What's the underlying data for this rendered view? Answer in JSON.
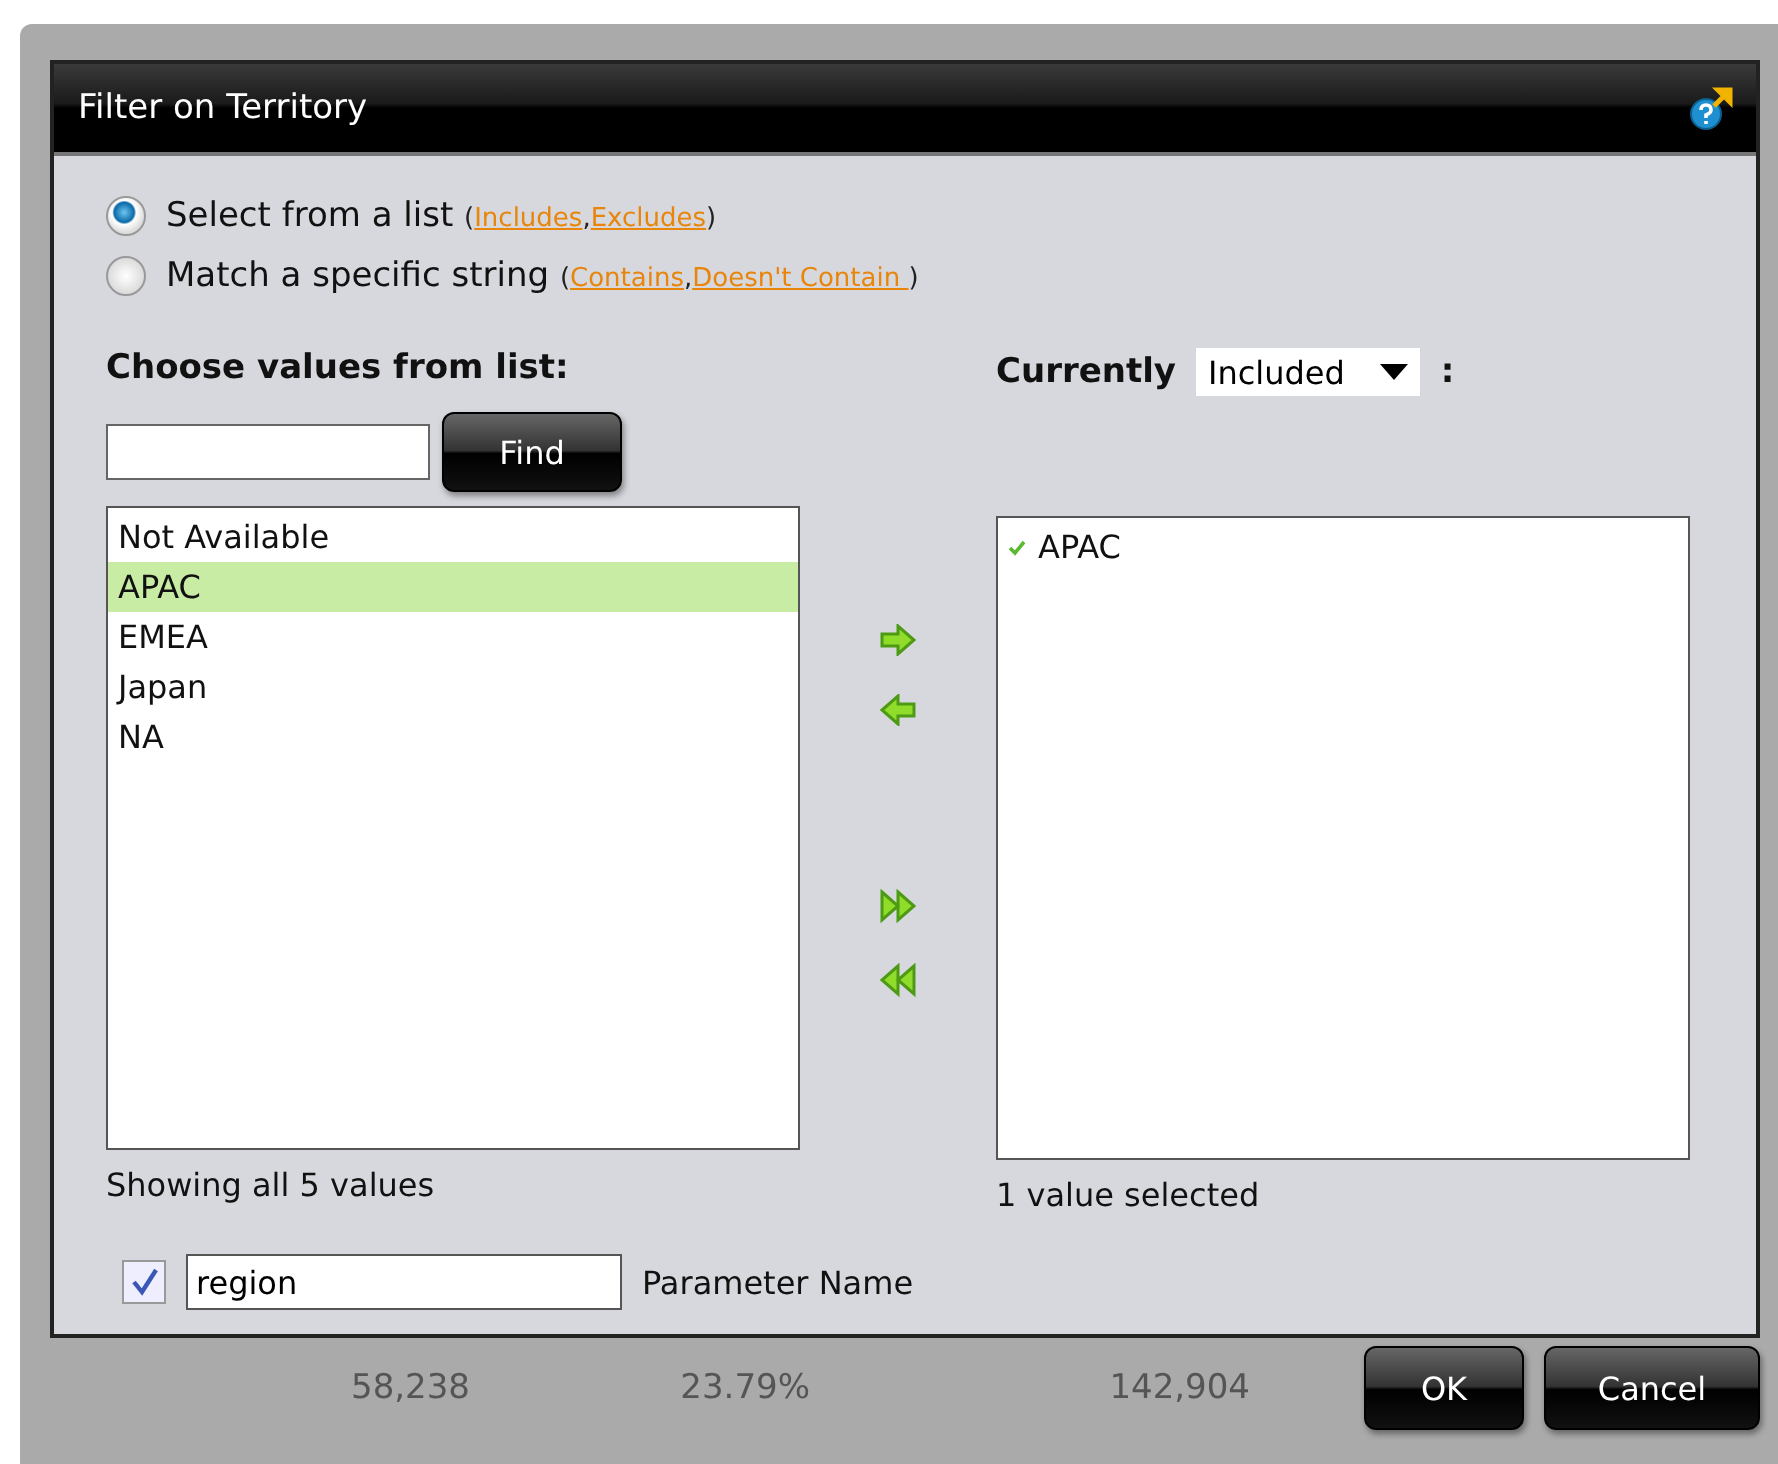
{
  "background_table": {
    "row": [
      "58,238",
      "23.79%",
      "142,904"
    ]
  },
  "dialog": {
    "title": "Filter on Territory"
  },
  "modes": [
    {
      "label": "Select from a list",
      "selected": true,
      "open": "(",
      "sep": ",",
      "close": ")",
      "links": [
        "Includes",
        "Excludes"
      ]
    },
    {
      "label": "Match a specific string",
      "selected": false,
      "open": "(",
      "sep": ",",
      "close": ")",
      "links": [
        "Contains",
        "Doesn't Contain "
      ]
    }
  ],
  "available": {
    "heading": "Choose values from list:",
    "find_button": "Find",
    "items": [
      {
        "label": "Not Available",
        "selected": false
      },
      {
        "label": "APAC",
        "selected": true
      },
      {
        "label": "EMEA",
        "selected": false
      },
      {
        "label": "Japan",
        "selected": false
      },
      {
        "label": "NA",
        "selected": false
      }
    ],
    "status": "Showing all 5 values"
  },
  "chosen": {
    "heading": "Currently",
    "filter_mode": "Included",
    "colon": ":",
    "items": [
      {
        "label": "APAC",
        "checked": true
      }
    ],
    "status": "1 value selected"
  },
  "parameter": {
    "checked": true,
    "value": "region",
    "label": "Parameter Name"
  },
  "buttons": [
    "OK",
    "Cancel"
  ]
}
